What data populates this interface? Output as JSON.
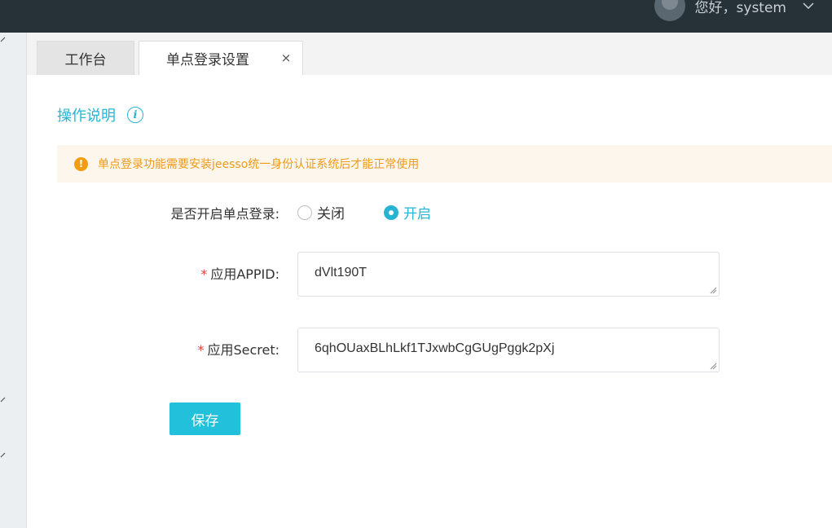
{
  "header": {
    "greeting": "您好，system",
    "avatar_icon": "user-avatar-icon",
    "dropdown_icon": "chevron-down-icon"
  },
  "tabs": [
    {
      "label": "工作台",
      "active": false
    },
    {
      "label": "单点登录设置",
      "active": true,
      "close_symbol": "×"
    }
  ],
  "section": {
    "title": "操作说明",
    "info_icon": "i"
  },
  "alert": {
    "icon": "!",
    "text": "单点登录功能需要安装jeesso统一身份认证系统后才能正常使用"
  },
  "form": {
    "enable_label": "是否开启单点登录:",
    "options": [
      {
        "label": "关闭",
        "selected": false
      },
      {
        "label": "开启",
        "selected": true
      }
    ],
    "appid_label": "应用APPID:",
    "appid_value": "dVlt190T",
    "secret_label": "应用Secret:",
    "secret_value": "6qhOUaxBLhLkf1TJxwbCgGUgPggk2pXj",
    "required_mark": "*",
    "save_label": "保存"
  },
  "colors": {
    "accent": "#27b4d3",
    "button": "#22c0da",
    "warning": "#f39c12",
    "topbar": "#263238"
  }
}
